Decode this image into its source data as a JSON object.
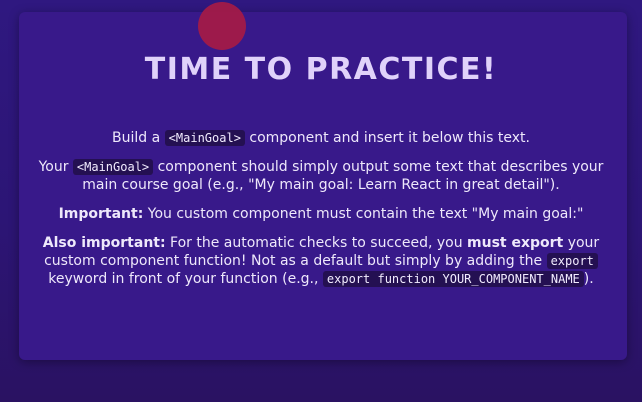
{
  "heading": "TIME TO PRACTICE!",
  "p1": {
    "before": "Build a ",
    "code": "<MainGoal>",
    "after": " component and insert it below this text."
  },
  "p2": {
    "before": "Your ",
    "code": "<MainGoal>",
    "after": " component should simply output some text that describes your main course goal (e.g., \"My main goal: Learn React in great detail\")."
  },
  "p3": {
    "strong": "Important:",
    "after": " You custom component must contain the text \"My main goal:\""
  },
  "p4": {
    "strong1": "Also important:",
    "text1": " For the automatic checks to succeed, you ",
    "strong2": "must export",
    "text2": " your custom component function! Not as a default but simply by adding the ",
    "code1": "export",
    "text3": " keyword in front of your function (e.g., ",
    "code2": "export function YOUR_COMPONENT_NAME",
    "text4": ")."
  },
  "colors": {
    "background": "#2b1470",
    "card": "#38198a",
    "heading": "#e0d2fa",
    "code_bg": "#241052",
    "cursor_dot": "#a21a48"
  }
}
